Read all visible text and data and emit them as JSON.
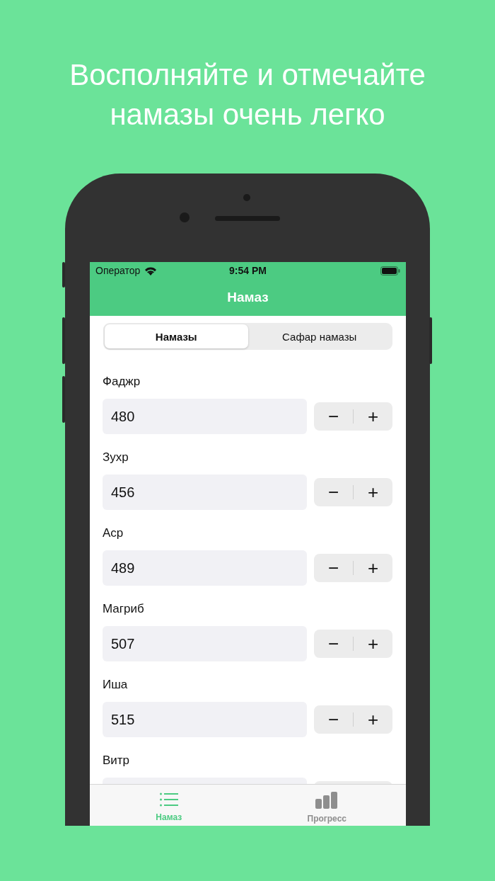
{
  "headline": "Восполняйте и отмечайте намазы очень легко",
  "status_bar": {
    "carrier": "Оператор",
    "time": "9:54 PM"
  },
  "nav_bar": {
    "title": "Намаз"
  },
  "segments": [
    {
      "label": "Намазы",
      "selected": true
    },
    {
      "label": "Сафар намазы",
      "selected": false
    }
  ],
  "prayers": [
    {
      "label": "Фаджр",
      "value": "480",
      "decrement": "−",
      "increment": "+"
    },
    {
      "label": "Зухр",
      "value": "456",
      "decrement": "−",
      "increment": "+"
    },
    {
      "label": "Аср",
      "value": "489",
      "decrement": "−",
      "increment": "+"
    },
    {
      "label": "Магриб",
      "value": "507",
      "decrement": "−",
      "increment": "+"
    },
    {
      "label": "Иша",
      "value": "515",
      "decrement": "−",
      "increment": "+"
    },
    {
      "label": "Витр"
    }
  ],
  "tab_bar": [
    {
      "label": "Намаз",
      "kind": "list",
      "selected": true
    },
    {
      "label": "Прогресс",
      "kind": "chart",
      "selected": false
    }
  ]
}
